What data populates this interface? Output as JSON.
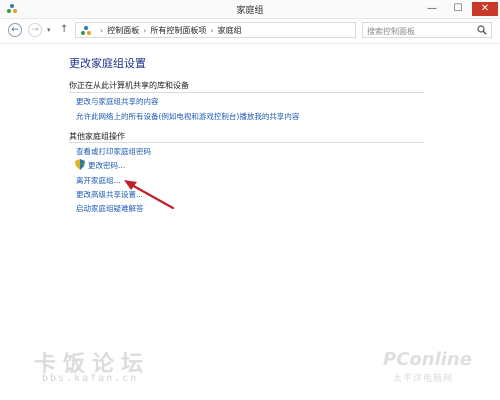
{
  "window": {
    "title": "家庭组",
    "minimize": "—",
    "maximize": "☐",
    "close": "✕"
  },
  "nav": {
    "back": "←",
    "forward": "→",
    "dropdown": "▾",
    "up": "↑",
    "refresh": "↻",
    "address_dropdown": "▾",
    "breadcrumb_sep": "›",
    "breadcrumbs": [
      "控制面板",
      "所有控制面板项",
      "家庭组"
    ]
  },
  "search": {
    "placeholder": "搜索控制面板"
  },
  "content": {
    "heading": "更改家庭组设置",
    "section1": {
      "title": "你正在从此计算机共享的库和设备",
      "links": [
        "更改与家庭组共享的内容",
        "允许此网络上的所有设备(例如电视和游戏控制台)播放我的共享内容"
      ]
    },
    "section2": {
      "title": "其他家庭组操作",
      "links": [
        "查看或打印家庭组密码",
        "更改密码...",
        "离开家庭组...",
        "更改高级共享设置...",
        "启动家庭组疑难解答"
      ]
    }
  },
  "watermark": {
    "left_text": "卡饭论坛",
    "url": "bbs.kafan.cn",
    "logo": "PConline",
    "logo_sub": "太平洋电脑网"
  },
  "colors": {
    "link": "#1e5bb4",
    "heading": "#1e3287",
    "arrow": "#c0202a",
    "close_button": "#c7392b"
  },
  "icons": {
    "app": "homegroup-icon",
    "address": "homegroup-icon",
    "search": "magnifier-icon",
    "uac": "uac-shield-icon"
  }
}
